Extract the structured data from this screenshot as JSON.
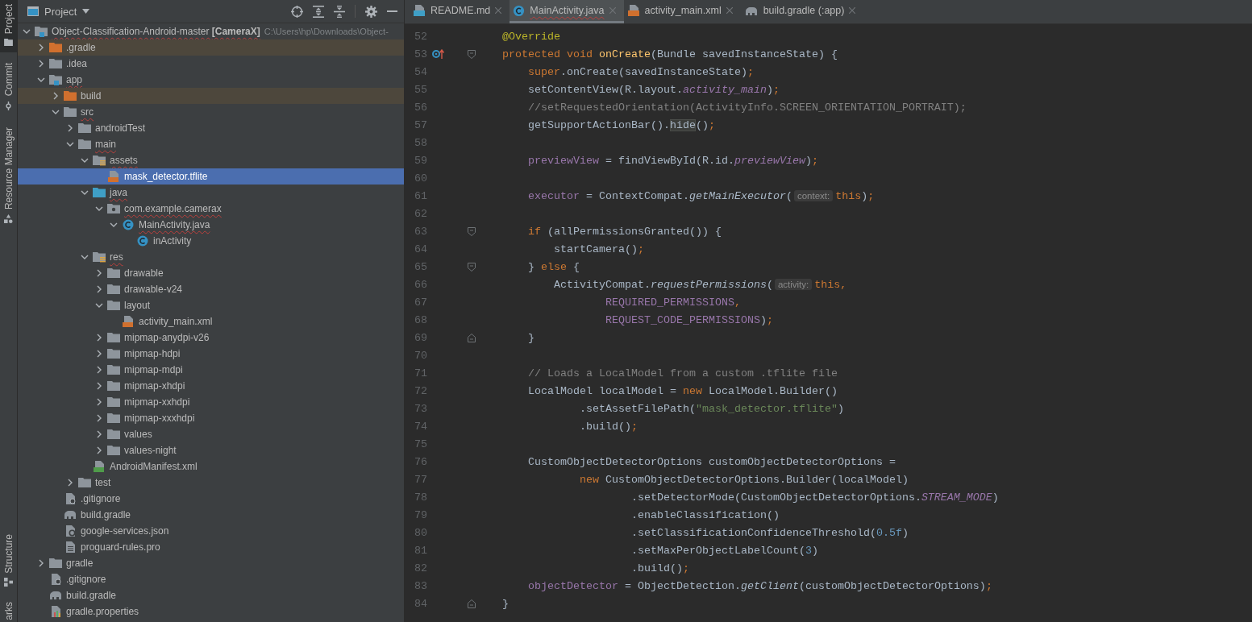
{
  "tool_strip": {
    "top": [
      {
        "label": "Project",
        "kind": "folder",
        "selected": true
      },
      {
        "label": "Commit",
        "kind": "commit",
        "selected": false
      },
      {
        "label": "Resource Manager",
        "kind": "resources",
        "selected": false
      }
    ],
    "bottom": [
      {
        "label": "Structure",
        "kind": "structure",
        "selected": false
      },
      {
        "label": "arks",
        "kind": "plain",
        "selected": false
      }
    ]
  },
  "project_panel": {
    "title": "Project",
    "tree": [
      {
        "label": "Object-Classification-Android-master **[CameraX]**",
        "path": "C:\\Users\\hp\\Downloads\\Object-",
        "kind": "module",
        "expanded": true,
        "selected": false,
        "excluded": false,
        "error": true,
        "children": [
          {
            "label": ".gradle",
            "kind": "folder-excluded",
            "expanded": false,
            "selected": false,
            "excluded": true,
            "error": false
          },
          {
            "label": ".idea",
            "kind": "folder",
            "expanded": false,
            "selected": false,
            "excluded": false,
            "error": false
          },
          {
            "label": "app",
            "kind": "module",
            "expanded": true,
            "selected": false,
            "excluded": false,
            "error": true,
            "children": [
              {
                "label": "build",
                "kind": "folder-excluded",
                "expanded": false,
                "selected": false,
                "excluded": true,
                "error": false
              },
              {
                "label": "src",
                "kind": "folder",
                "expanded": true,
                "selected": false,
                "excluded": false,
                "error": true,
                "children": [
                  {
                    "label": "androidTest",
                    "kind": "folder",
                    "expanded": false,
                    "selected": false,
                    "excluded": false,
                    "error": false
                  },
                  {
                    "label": "main",
                    "kind": "folder",
                    "expanded": true,
                    "selected": false,
                    "excluded": false,
                    "error": true,
                    "children": [
                      {
                        "label": "assets",
                        "kind": "folder-assets",
                        "expanded": true,
                        "selected": false,
                        "excluded": false,
                        "error": true,
                        "children": [
                          {
                            "label": "mask_detector.tflite",
                            "kind": "file-tflite",
                            "selected": true,
                            "excluded": false,
                            "error": false
                          }
                        ]
                      },
                      {
                        "label": "java",
                        "kind": "folder-source",
                        "expanded": true,
                        "selected": false,
                        "excluded": false,
                        "error": true,
                        "children": [
                          {
                            "label": "com.example.camerax",
                            "kind": "package",
                            "expanded": true,
                            "selected": false,
                            "excluded": false,
                            "error": true,
                            "children": [
                              {
                                "label": "MainActivity.java",
                                "kind": "class",
                                "expanded": true,
                                "selected": false,
                                "excluded": false,
                                "error": true,
                                "children": [
                                  {
                                    "label": "inActivity",
                                    "kind": "class",
                                    "selected": false,
                                    "excluded": false,
                                    "error": false
                                  }
                                ]
                              }
                            ]
                          }
                        ]
                      },
                      {
                        "label": "res",
                        "kind": "folder-res",
                        "expanded": true,
                        "selected": false,
                        "excluded": false,
                        "error": true,
                        "children": [
                          {
                            "label": "drawable",
                            "kind": "folder",
                            "expanded": false,
                            "selected": false,
                            "excluded": false,
                            "error": false
                          },
                          {
                            "label": "drawable-v24",
                            "kind": "folder",
                            "expanded": false,
                            "selected": false,
                            "excluded": false,
                            "error": false
                          },
                          {
                            "label": "layout",
                            "kind": "folder",
                            "expanded": true,
                            "selected": false,
                            "excluded": false,
                            "error": false,
                            "children": [
                              {
                                "label": "activity_main.xml",
                                "kind": "file-xml",
                                "selected": false,
                                "excluded": false,
                                "error": false
                              }
                            ]
                          },
                          {
                            "label": "mipmap-anydpi-v26",
                            "kind": "folder",
                            "expanded": false,
                            "selected": false,
                            "excluded": false,
                            "error": false
                          },
                          {
                            "label": "mipmap-hdpi",
                            "kind": "folder",
                            "expanded": false,
                            "selected": false,
                            "excluded": false,
                            "error": false
                          },
                          {
                            "label": "mipmap-mdpi",
                            "kind": "folder",
                            "expanded": false,
                            "selected": false,
                            "excluded": false,
                            "error": false
                          },
                          {
                            "label": "mipmap-xhdpi",
                            "kind": "folder",
                            "expanded": false,
                            "selected": false,
                            "excluded": false,
                            "error": false
                          },
                          {
                            "label": "mipmap-xxhdpi",
                            "kind": "folder",
                            "expanded": false,
                            "selected": false,
                            "excluded": false,
                            "error": false
                          },
                          {
                            "label": "mipmap-xxxhdpi",
                            "kind": "folder",
                            "expanded": false,
                            "selected": false,
                            "excluded": false,
                            "error": false
                          },
                          {
                            "label": "values",
                            "kind": "folder",
                            "expanded": false,
                            "selected": false,
                            "excluded": false,
                            "error": false
                          },
                          {
                            "label": "values-night",
                            "kind": "folder",
                            "expanded": false,
                            "selected": false,
                            "excluded": false,
                            "error": false
                          }
                        ]
                      },
                      {
                        "label": "AndroidManifest.xml",
                        "kind": "file-manifest",
                        "selected": false,
                        "excluded": false,
                        "error": false
                      }
                    ]
                  },
                  {
                    "label": "test",
                    "kind": "folder",
                    "expanded": false,
                    "selected": false,
                    "excluded": false,
                    "error": false
                  }
                ]
              },
              {
                "label": ".gitignore",
                "kind": "file-ignore",
                "selected": false,
                "excluded": false,
                "error": false
              },
              {
                "label": "build.gradle",
                "kind": "gradle",
                "selected": false,
                "excluded": false,
                "error": false
              },
              {
                "label": "google-services.json",
                "kind": "file-json",
                "selected": false,
                "excluded": false,
                "error": false
              },
              {
                "label": "proguard-rules.pro",
                "kind": "file-text",
                "selected": false,
                "excluded": false,
                "error": false
              }
            ]
          },
          {
            "label": "gradle",
            "kind": "folder",
            "expanded": false,
            "selected": false,
            "excluded": false,
            "error": false
          },
          {
            "label": ".gitignore",
            "kind": "file-ignore",
            "selected": false,
            "excluded": false,
            "error": false
          },
          {
            "label": "build.gradle",
            "kind": "gradle",
            "selected": false,
            "excluded": false,
            "error": false
          },
          {
            "label": "gradle.properties",
            "kind": "file-properties",
            "selected": false,
            "excluded": false,
            "error": false
          }
        ]
      }
    ]
  },
  "editor": {
    "tabs": [
      {
        "label": "README.md",
        "kind": "md",
        "selected": false,
        "error": false
      },
      {
        "label": "MainActivity.java",
        "kind": "class",
        "selected": true,
        "error": true
      },
      {
        "label": "activity_main.xml",
        "kind": "xml",
        "selected": false,
        "error": false
      },
      {
        "label": "build.gradle (:app)",
        "kind": "gradle",
        "selected": false,
        "error": false
      }
    ],
    "lines": [
      {
        "number": "52",
        "kind": "plain",
        "tokens": [
          {
            "text": "    @Override",
            "kind": "ann"
          }
        ]
      },
      {
        "number": "53",
        "kind": "override-fold",
        "tokens": [
          {
            "text": "    protected void ",
            "kind": "kw"
          },
          {
            "text": "onCreate",
            "kind": "decl"
          },
          {
            "text": "(Bundle savedInstanceState) {",
            "kind": "plain"
          }
        ]
      },
      {
        "number": "54",
        "kind": "plain",
        "tokens": [
          {
            "text": "        super",
            "kind": "kw"
          },
          {
            "text": ".onCreate(savedInstanceState)",
            "kind": "plain"
          },
          {
            "text": ";",
            "kind": "kw"
          }
        ]
      },
      {
        "number": "55",
        "kind": "plain",
        "tokens": [
          {
            "text": "        setContentView(R.layout.",
            "kind": "plain"
          },
          {
            "text": "activity_main",
            "kind": "field-i"
          },
          {
            "text": ")",
            "kind": "plain"
          },
          {
            "text": ";",
            "kind": "kw"
          }
        ]
      },
      {
        "number": "56",
        "kind": "plain",
        "tokens": [
          {
            "text": "        //setRequestedOrientation(ActivityInfo.SCREEN_ORIENTATION_PORTRAIT);",
            "kind": "cmt"
          }
        ]
      },
      {
        "number": "57",
        "kind": "plain",
        "tokens": [
          {
            "text": "        getSupportActionBar().",
            "kind": "plain"
          },
          {
            "text": "hide",
            "kind": "hl"
          },
          {
            "text": "()",
            "kind": "plain"
          },
          {
            "text": ";",
            "kind": "kw"
          }
        ]
      },
      {
        "number": "58",
        "kind": "plain"
      },
      {
        "number": "59",
        "kind": "plain",
        "tokens": [
          {
            "text": "        previewView",
            "kind": "field"
          },
          {
            "text": " = findViewById(R.id.",
            "kind": "plain"
          },
          {
            "text": "previewView",
            "kind": "field-i"
          },
          {
            "text": ")",
            "kind": "plain"
          },
          {
            "text": ";",
            "kind": "kw"
          }
        ]
      },
      {
        "number": "60",
        "kind": "plain"
      },
      {
        "number": "61",
        "kind": "plain",
        "tokens": [
          {
            "text": "        executor",
            "kind": "field"
          },
          {
            "text": " = ContextCompat.",
            "kind": "plain"
          },
          {
            "text": "getMainExecutor",
            "kind": "ital"
          },
          {
            "text": "(",
            "kind": "plain"
          },
          {
            "text": "context:",
            "kind": "hint"
          },
          {
            "text": "this",
            "kind": "kw"
          },
          {
            "text": ")",
            "kind": "plain"
          },
          {
            "text": ";",
            "kind": "kw"
          }
        ]
      },
      {
        "number": "62",
        "kind": "plain"
      },
      {
        "number": "63",
        "kind": "fold-start",
        "tokens": [
          {
            "text": "        if",
            "kind": "kw"
          },
          {
            "text": " (allPermissionsGranted()) {",
            "kind": "plain"
          }
        ]
      },
      {
        "number": "64",
        "kind": "plain",
        "tokens": [
          {
            "text": "            startCamera()",
            "kind": "plain"
          },
          {
            "text": ";",
            "kind": "kw"
          }
        ]
      },
      {
        "number": "65",
        "kind": "fold-start",
        "tokens": [
          {
            "text": "        } ",
            "kind": "plain"
          },
          {
            "text": "else",
            "kind": "kw"
          },
          {
            "text": " {",
            "kind": "plain"
          }
        ]
      },
      {
        "number": "66",
        "kind": "plain",
        "tokens": [
          {
            "text": "            ActivityCompat.",
            "kind": "plain"
          },
          {
            "text": "requestPermissions",
            "kind": "ital"
          },
          {
            "text": "(",
            "kind": "plain"
          },
          {
            "text": "activity:",
            "kind": "hint"
          },
          {
            "text": "this,",
            "kind": "kw"
          }
        ]
      },
      {
        "number": "67",
        "kind": "plain",
        "tokens": [
          {
            "text": "                    REQUIRED_PERMISSIONS",
            "kind": "field"
          },
          {
            "text": ",",
            "kind": "kw"
          }
        ]
      },
      {
        "number": "68",
        "kind": "plain",
        "tokens": [
          {
            "text": "                    REQUEST_CODE_PERMISSIONS",
            "kind": "field"
          },
          {
            "text": ")",
            "kind": "plain"
          },
          {
            "text": ";",
            "kind": "kw"
          }
        ]
      },
      {
        "number": "69",
        "kind": "fold-end",
        "tokens": [
          {
            "text": "        }",
            "kind": "plain"
          }
        ]
      },
      {
        "number": "70",
        "kind": "plain"
      },
      {
        "number": "71",
        "kind": "plain",
        "tokens": [
          {
            "text": "        // Loads a LocalModel from a custom .tflite file",
            "kind": "cmt"
          }
        ]
      },
      {
        "number": "72",
        "kind": "plain",
        "tokens": [
          {
            "text": "        LocalModel localModel = ",
            "kind": "plain"
          },
          {
            "text": "new",
            "kind": "kw"
          },
          {
            "text": " LocalModel.Builder()",
            "kind": "plain"
          }
        ]
      },
      {
        "number": "73",
        "kind": "plain",
        "tokens": [
          {
            "text": "                .setAssetFilePath(",
            "kind": "plain"
          },
          {
            "text": "\"mask_detector.tflite\"",
            "kind": "str"
          },
          {
            "text": ")",
            "kind": "plain"
          }
        ]
      },
      {
        "number": "74",
        "kind": "plain",
        "tokens": [
          {
            "text": "                .build()",
            "kind": "plain"
          },
          {
            "text": ";",
            "kind": "kw"
          }
        ]
      },
      {
        "number": "75",
        "kind": "plain"
      },
      {
        "number": "76",
        "kind": "plain",
        "tokens": [
          {
            "text": "        CustomObjectDetectorOptions customObjectDetectorOptions =",
            "kind": "plain"
          }
        ]
      },
      {
        "number": "77",
        "kind": "plain",
        "tokens": [
          {
            "text": "                new",
            "kind": "kw"
          },
          {
            "text": " CustomObjectDetectorOptions.Builder(localModel)",
            "kind": "plain"
          }
        ]
      },
      {
        "number": "78",
        "kind": "plain",
        "tokens": [
          {
            "text": "                        .setDetectorMode(CustomObjectDetectorOptions.",
            "kind": "plain"
          },
          {
            "text": "STREAM_MODE",
            "kind": "field-i"
          },
          {
            "text": ")",
            "kind": "plain"
          }
        ]
      },
      {
        "number": "79",
        "kind": "plain",
        "tokens": [
          {
            "text": "                        .enableClassification()",
            "kind": "plain"
          }
        ]
      },
      {
        "number": "80",
        "kind": "plain",
        "tokens": [
          {
            "text": "                        .setClassificationConfidenceThreshold(",
            "kind": "plain"
          },
          {
            "text": "0.5f",
            "kind": "num"
          },
          {
            "text": ")",
            "kind": "plain"
          }
        ]
      },
      {
        "number": "81",
        "kind": "plain",
        "tokens": [
          {
            "text": "                        .setMaxPerObjectLabelCount(",
            "kind": "plain"
          },
          {
            "text": "3",
            "kind": "num"
          },
          {
            "text": ")",
            "kind": "plain"
          }
        ]
      },
      {
        "number": "82",
        "kind": "plain",
        "tokens": [
          {
            "text": "                        .build()",
            "kind": "plain"
          },
          {
            "text": ";",
            "kind": "kw"
          }
        ]
      },
      {
        "number": "83",
        "kind": "plain",
        "tokens": [
          {
            "text": "        objectDetector",
            "kind": "field"
          },
          {
            "text": " = ObjectDetection.",
            "kind": "plain"
          },
          {
            "text": "getClient",
            "kind": "ital"
          },
          {
            "text": "(customObjectDetectorOptions)",
            "kind": "plain"
          },
          {
            "text": ";",
            "kind": "kw"
          }
        ]
      },
      {
        "number": "84",
        "kind": "fold-end",
        "tokens": [
          {
            "text": "    }",
            "kind": "plain"
          }
        ]
      }
    ]
  }
}
